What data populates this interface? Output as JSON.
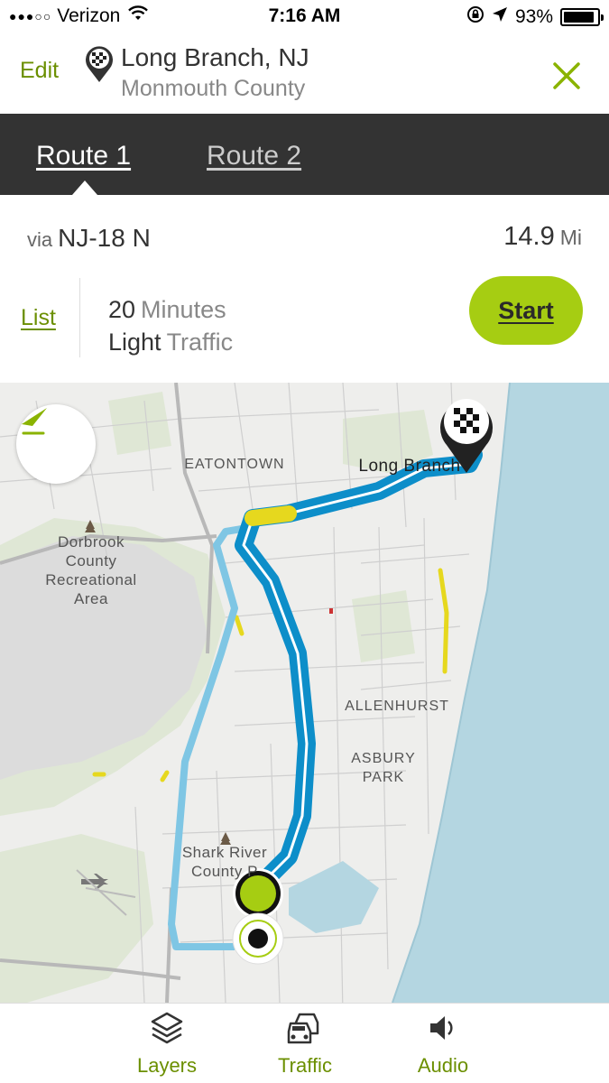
{
  "status_bar": {
    "signal_dots": "●●●○○",
    "carrier": "Verizon",
    "time": "7:16 AM",
    "battery": "93%",
    "battery_level": 0.93,
    "icons": [
      "wifi-icon",
      "rotation-lock-icon",
      "location-arrow-icon",
      "battery-icon"
    ]
  },
  "header": {
    "edit_label": "Edit",
    "destination_title": "Long Branch, NJ",
    "destination_subtitle": "Monmouth County",
    "icons": [
      "checkered-flag-pin-icon",
      "close-icon"
    ]
  },
  "tabs": [
    {
      "label": "Route 1",
      "selected": true
    },
    {
      "label": "Route 2",
      "selected": false
    }
  ],
  "route": {
    "via_label": "via",
    "via_road": "NJ-18 N",
    "distance": "14.9",
    "distance_unit": "Mi",
    "list_label": "List",
    "duration_value": "20",
    "duration_label": "Minutes",
    "traffic_value": "Light",
    "traffic_label": "Traffic",
    "start_label": "Start"
  },
  "map": {
    "labels": {
      "eatontown": "EATONTOWN",
      "long_branch": "Long Branch",
      "dorbrook_1": "Dorbrook",
      "dorbrook_2": "County",
      "dorbrook_3": "Recreational",
      "dorbrook_4": "Area",
      "allenhurst": "ALLENHURST",
      "asbury_1": "ASBURY",
      "asbury_2": "PARK",
      "shark_1": "Shark River",
      "shark_2": "County P"
    },
    "colors": {
      "route_primary": "#0d8ec9",
      "route_alternate": "#7fc6e4",
      "traffic_yellow": "#e6d81e",
      "water": "#b4d6e1",
      "accent": "#a6cd12"
    }
  },
  "bottom_bar": {
    "layers_label": "Layers",
    "traffic_label": "Traffic",
    "audio_label": "Audio"
  }
}
